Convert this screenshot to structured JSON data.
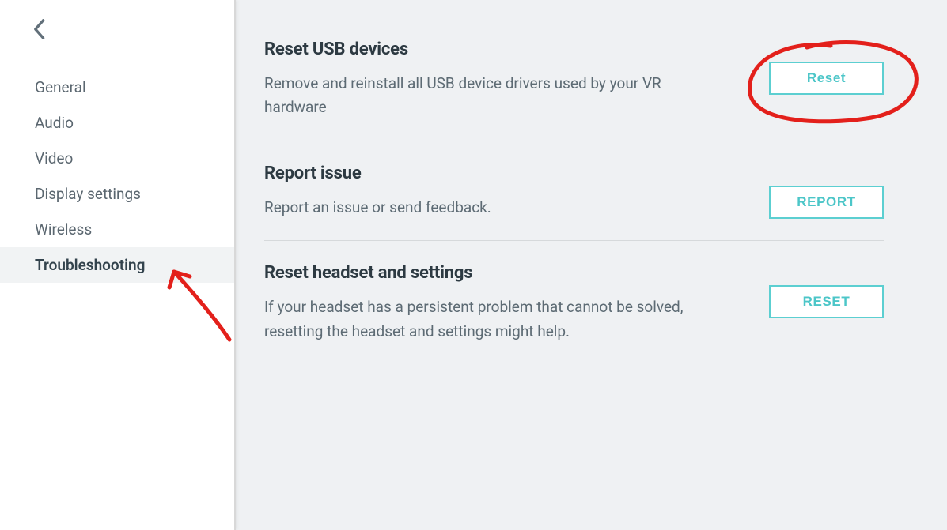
{
  "sidebar": {
    "items": [
      {
        "label": "General"
      },
      {
        "label": "Audio"
      },
      {
        "label": "Video"
      },
      {
        "label": "Display settings"
      },
      {
        "label": "Wireless"
      },
      {
        "label": "Troubleshooting",
        "selected": true
      }
    ]
  },
  "sections": {
    "reset_usb": {
      "title": "Reset USB devices",
      "desc": "Remove and reinstall all USB device drivers used by your VR hardware",
      "button": "Reset"
    },
    "report_issue": {
      "title": "Report issue",
      "desc": "Report an issue or send feedback.",
      "button": "REPORT"
    },
    "reset_headset": {
      "title": "Reset headset and settings",
      "desc": "If your headset has a persistent problem that cannot be solved, resetting the headset and settings might help.",
      "button": "RESET"
    }
  }
}
